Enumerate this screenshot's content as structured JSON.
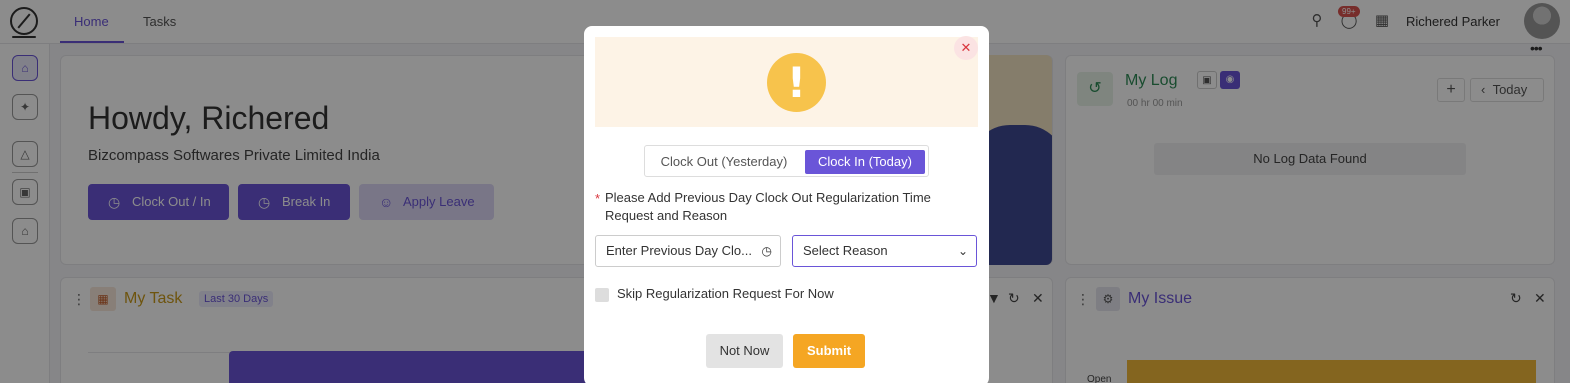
{
  "header": {
    "tabs": [
      {
        "label": "Home",
        "active": true
      },
      {
        "label": "Tasks",
        "active": false
      }
    ],
    "notification_badge": "99+",
    "user_name": "Richered Parker"
  },
  "hero": {
    "greeting": "Howdy, Richered",
    "company": "Bizcompass Softwares Private Limited India",
    "buttons": [
      "Clock Out / In",
      "Break In",
      "Apply Leave"
    ]
  },
  "my_log": {
    "title": "My Log",
    "duration": "00 hr 00 min",
    "today_label": "Today",
    "empty_text": "No Log Data Found"
  },
  "my_task": {
    "title": "My Task",
    "badge": "Last 30 Days"
  },
  "my_issue": {
    "title": "My Issue",
    "axis_label": "Open"
  },
  "modal": {
    "close_icon": "close-icon",
    "warning_icon": "exclamation-icon",
    "segment": {
      "options": [
        "Clock Out (Yesterday)",
        "Clock In (Today)"
      ],
      "selected": "Clock In (Today)"
    },
    "required_marker": "*",
    "instruction": "Please Add Previous Day Clock Out Regularization Time Request and Reason",
    "time_input": {
      "placeholder": "Enter Previous Day Clo...",
      "value": ""
    },
    "reason_select": {
      "selected": "Select Reason"
    },
    "skip_checkbox": {
      "label": "Skip Regularization Request For Now",
      "checked": false
    },
    "buttons": {
      "not_now": "Not Now",
      "submit": "Submit"
    }
  },
  "colors": {
    "accent": "#6a55d8",
    "submit": "#f5a623",
    "warning": "#f7c34c",
    "overlay": "rgba(0,0,0,0.45)"
  }
}
